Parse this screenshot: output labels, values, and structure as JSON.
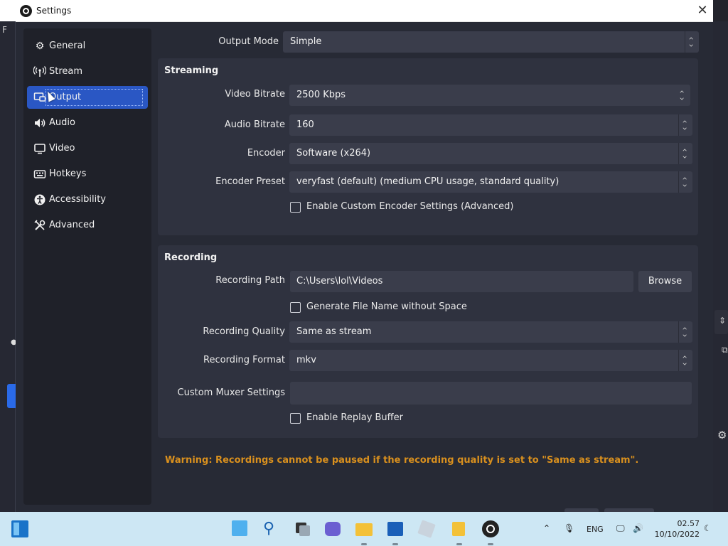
{
  "window": {
    "title": "Settings"
  },
  "background": {
    "left_letter": "F"
  },
  "sidebar": {
    "items": [
      {
        "label": "General",
        "icon": "gear-icon"
      },
      {
        "label": "Stream",
        "icon": "broadcast-icon"
      },
      {
        "label": "Output",
        "icon": "output-icon",
        "active": true
      },
      {
        "label": "Audio",
        "icon": "speaker-icon"
      },
      {
        "label": "Video",
        "icon": "monitor-icon"
      },
      {
        "label": "Hotkeys",
        "icon": "keyboard-icon"
      },
      {
        "label": "Accessibility",
        "icon": "accessibility-icon"
      },
      {
        "label": "Advanced",
        "icon": "tools-icon"
      }
    ]
  },
  "output_mode": {
    "label": "Output Mode",
    "value": "Simple"
  },
  "streaming": {
    "title": "Streaming",
    "video_bitrate": {
      "label": "Video Bitrate",
      "value": "2500 Kbps"
    },
    "audio_bitrate": {
      "label": "Audio Bitrate",
      "value": "160"
    },
    "encoder": {
      "label": "Encoder",
      "value": "Software (x264)"
    },
    "encoder_preset": {
      "label": "Encoder Preset",
      "value": "veryfast (default) (medium CPU usage, standard quality)"
    },
    "custom_encoder": {
      "label": "Enable Custom Encoder Settings (Advanced)",
      "checked": false
    }
  },
  "recording": {
    "title": "Recording",
    "path": {
      "label": "Recording Path",
      "value": "C:\\Users\\lol\\Videos",
      "browse_label": "Browse"
    },
    "file_name_no_space": {
      "label": "Generate File Name without Space",
      "checked": false
    },
    "quality": {
      "label": "Recording Quality",
      "value": "Same as stream"
    },
    "format": {
      "label": "Recording Format",
      "value": "mkv"
    },
    "muxer": {
      "label": "Custom Muxer Settings",
      "value": ""
    },
    "replay_buffer": {
      "label": "Enable Replay Buffer",
      "checked": false
    }
  },
  "warning": "Warning: Recordings cannot be paused if the recording quality is set to \"Same as stream\".",
  "taskbar": {
    "language": "ENG",
    "time": "02.57",
    "date": "10/10/2022"
  },
  "colors": {
    "accent": "#2a57c4",
    "warning": "#d9901e",
    "panel": "#2f323f",
    "background": "#272a35"
  }
}
